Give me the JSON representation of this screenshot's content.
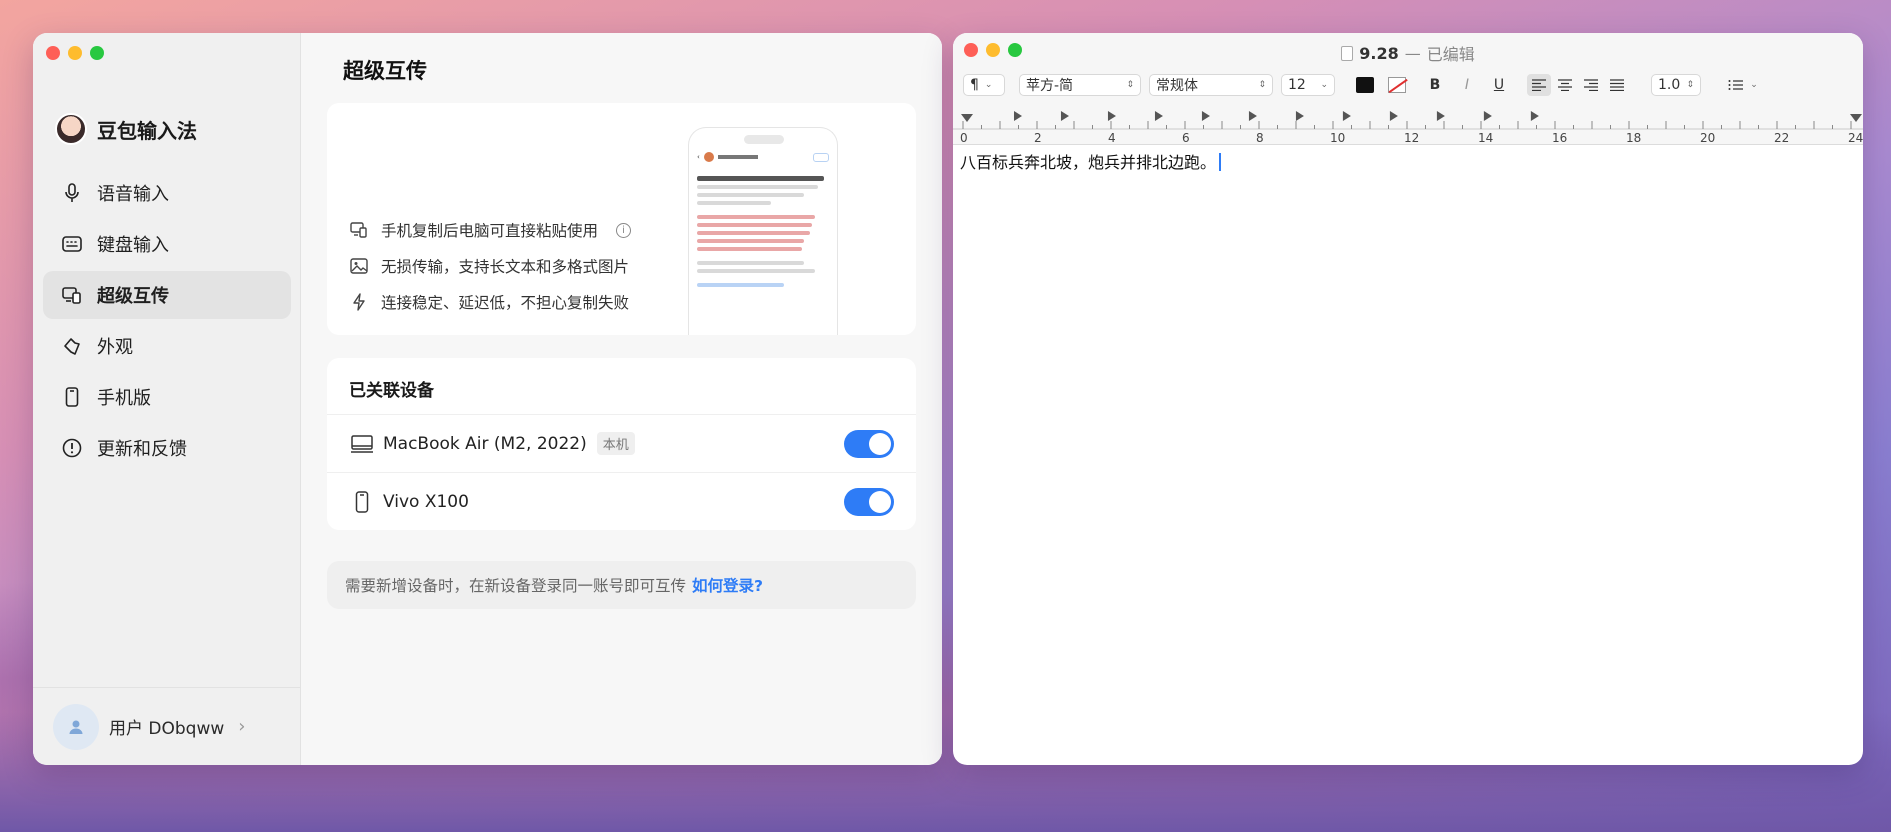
{
  "left_window": {
    "app_name": "豆包输入法",
    "nav": [
      {
        "label": "语音输入",
        "icon": "microphone-icon"
      },
      {
        "label": "键盘输入",
        "icon": "keyboard-icon"
      },
      {
        "label": "超级互传",
        "icon": "devices-icon",
        "active": true
      },
      {
        "label": "外观",
        "icon": "appearance-icon"
      },
      {
        "label": "手机版",
        "icon": "phone-icon"
      },
      {
        "label": "更新和反馈",
        "icon": "alert-circle-icon"
      }
    ],
    "user": {
      "name": "用户 DObqww"
    },
    "page_title": "超级互传",
    "features": [
      {
        "text": "手机复制后电脑可直接粘贴使用",
        "icon": "devices-icon"
      },
      {
        "text": "无损传输，支持长文本和多格式图片",
        "icon": "image-icon"
      },
      {
        "text": "连接稳定、延迟低，不担心复制失败",
        "icon": "lightning-icon"
      }
    ],
    "devices": {
      "title": "已关联设备",
      "items": [
        {
          "name": "MacBook Air (M2, 2022)",
          "badge": "本机",
          "icon": "laptop-icon",
          "enabled": true
        },
        {
          "name": "Vivo X100",
          "badge": "",
          "icon": "phone-icon",
          "enabled": true
        }
      ]
    },
    "note": {
      "text": "需要新增设备时，在新设备登录同一账号即可互传",
      "link": "如何登录?"
    }
  },
  "right_window": {
    "title_name": "9.28",
    "title_sep": "—",
    "title_status": "已编辑",
    "toolbar": {
      "paragraph": "¶",
      "font_family": "苹方-简",
      "font_style": "常规体",
      "font_size": "12",
      "line_spacing": "1.0",
      "bold": "B",
      "italic": "I",
      "underline": "U"
    },
    "ruler_labels": [
      "0",
      "2",
      "4",
      "6",
      "8",
      "10",
      "12",
      "14",
      "16",
      "18",
      "20",
      "22",
      "24"
    ],
    "body_text": "八百标兵奔北坡，炮兵并排北边跑。"
  }
}
